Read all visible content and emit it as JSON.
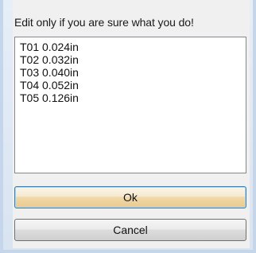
{
  "caption": "Edit only if you are sure what you do!",
  "textarea": {
    "lines": [
      "T01 0.024in",
      "T02 0.032in",
      "T03 0.040in",
      "T04 0.052in",
      "T05 0.126in"
    ]
  },
  "buttons": {
    "ok": "Ok",
    "cancel": "Cancel"
  }
}
